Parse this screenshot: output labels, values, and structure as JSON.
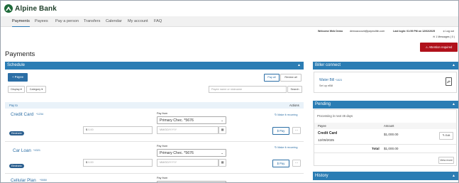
{
  "brand": {
    "name": "Alpine Bank"
  },
  "nav": {
    "items": [
      "Payments",
      "Payees",
      "Pay a person",
      "Transfers",
      "Calendar",
      "My account",
      "FAQ"
    ]
  },
  "user_bar": {
    "welcome": "Welcome Web Demo",
    "email": "demoaccount@paymultiln.com",
    "last_login": "Last login: 01:59 PM on 12/02/2025",
    "logout": "Log out",
    "messages": "1 Messages",
    "messages_count": "0"
  },
  "attention": "Attention required",
  "page_title": "Payments",
  "schedule": {
    "title": "Schedule",
    "add_payee": "+ Payee",
    "pay_all": "Pay all",
    "review_all": "Review all",
    "display": "Display",
    "category": "Category",
    "search_placeholder": "Payee name or nickname",
    "search_btn": "Search",
    "col_payto": "Pay to",
    "col_actions": "Actions",
    "pay_from_label": "Pay from",
    "recurring_label": "Make it recurring",
    "amount_placeholder": "0.00",
    "date_placeholder": "MM/DD/YYYY",
    "pay_label": "Pay",
    "payees": [
      {
        "name": "Credit Card",
        "acct": "*1234",
        "tag": "Electronic",
        "from": "Primary Chec. *5676"
      },
      {
        "name": "Car Loan",
        "acct": "*4321",
        "tag": "Electronic",
        "from": "Primary Chec. *5676"
      },
      {
        "name": "Cellular Plan",
        "acct": "*5550",
        "from": ""
      }
    ]
  },
  "biller": {
    "title": "Biller connect",
    "item": "Water Bill",
    "item_acct": "*1523",
    "sub": "Set up eBill"
  },
  "pending": {
    "title": "Pending",
    "subtitle": "Processing in next 45 days",
    "col_payee": "Payee",
    "col_amount": "Amount",
    "row_name": "Credit Card",
    "row_date": "12/09/2025",
    "row_amount": "$1,000.00",
    "edit": "Edit",
    "total_label": "Total",
    "total_value": "$1,000.00",
    "view_more": "View more"
  },
  "history": {
    "title": "History"
  },
  "colors": {
    "accent": "#2b7db4",
    "alert": "#b0111b",
    "brand": "#1f6b3a"
  }
}
